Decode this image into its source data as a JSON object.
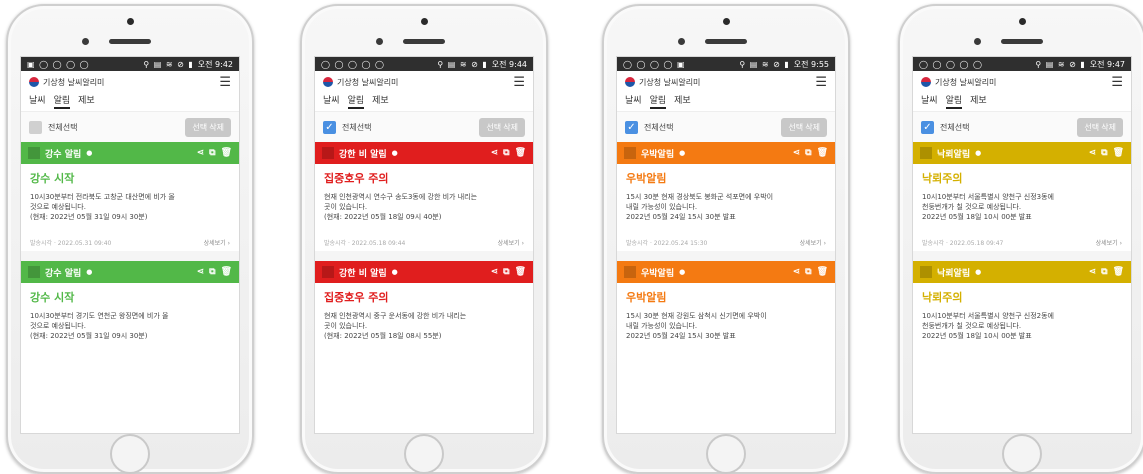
{
  "phones": [
    {
      "status": {
        "left_icons": "▣ ◯ ◯ ◯ ◯",
        "right_icons": "⚲ ▤ ≋ ⊘ ▮",
        "time": "오전 9:42"
      },
      "app_title": "기상청 날씨알리미",
      "tabs": [
        "날씨",
        "알림",
        "제보"
      ],
      "select_all_label": "전체선택",
      "select_all_checked": false,
      "delete_label": "선택 삭제",
      "accent": "#52b848",
      "alerts": [
        {
          "header": "강수 알림",
          "title": "강수 시작",
          "body": [
            "10시30분부터 전라북도 고창군 대산면에 비가 올",
            "것으로 예상됩니다.",
            "(현재: 2022년 05월 31일 09시 30분)"
          ],
          "meta_left": "발송시각 · 2022.05.31 09:40",
          "meta_right": "상세보기 ›"
        },
        {
          "header": "강수 알림",
          "title": "강수 시작",
          "body": [
            "10시30분부터 경기도 연천군 왕징면에 비가 올",
            "것으로 예상됩니다.",
            "(현재: 2022년 05월 31일 09시 30분)"
          ],
          "meta_left": "",
          "meta_right": ""
        }
      ]
    },
    {
      "status": {
        "left_icons": "◯ ◯ ◯ ◯ ◯",
        "right_icons": "⚲ ▤ ≋ ⊘ ▮",
        "time": "오전 9:44"
      },
      "app_title": "기상청 날씨알리미",
      "tabs": [
        "날씨",
        "알림",
        "제보"
      ],
      "select_all_label": "전체선택",
      "select_all_checked": true,
      "delete_label": "선택 삭제",
      "accent": "#e01e1e",
      "alerts": [
        {
          "header": "강한 비 알림",
          "title": "집중호우 주의",
          "body": [
            "현재 인천광역시 연수구 송도3동에 강한 비가 내리는",
            "곳이 있습니다.",
            "(현재: 2022년 05월 18일 09시 40분)"
          ],
          "meta_left": "발송시각 · 2022.05.18 09:44",
          "meta_right": "상세보기 ›"
        },
        {
          "header": "강한 비 알림",
          "title": "집중호우 주의",
          "body": [
            "현재 인천광역시 중구 운서동에 강한 비가 내리는",
            "곳이 있습니다.",
            "(현재: 2022년 05월 18일 08시 55분)"
          ],
          "meta_left": "",
          "meta_right": ""
        }
      ]
    },
    {
      "status": {
        "left_icons": "◯ ◯ ◯ ◯ ▣",
        "right_icons": "⚲ ▤ ≋ ⊘ ▮",
        "time": "오전 9:55"
      },
      "app_title": "기상청 날씨알리미",
      "tabs": [
        "날씨",
        "알림",
        "제보"
      ],
      "select_all_label": "전체선택",
      "select_all_checked": true,
      "delete_label": "선택 삭제",
      "accent": "#f47a12",
      "alerts": [
        {
          "header": "우박알림",
          "title": "우박알림",
          "body": [
            "15시 30분 현재 경상북도 봉화군 석포면에 우박이",
            "내릴 가능성이 있습니다.",
            "2022년 05월 24일 15시 30분 발표"
          ],
          "meta_left": "발송시각 · 2022.05.24 15:30",
          "meta_right": "상세보기 ›"
        },
        {
          "header": "우박알림",
          "title": "우박알림",
          "body": [
            "15시 30분 현재 강원도 삼척시 신기면에 우박이",
            "내릴 가능성이 있습니다.",
            "2022년 05월 24일 15시 30분 발표"
          ],
          "meta_left": "",
          "meta_right": ""
        }
      ]
    },
    {
      "status": {
        "left_icons": "◯ ◯ ◯ ◯ ◯",
        "right_icons": "⚲ ▤ ≋ ⊘ ▮",
        "time": "오전 9:47"
      },
      "app_title": "기상청 날씨알리미",
      "tabs": [
        "날씨",
        "알림",
        "제보"
      ],
      "select_all_label": "전체선택",
      "select_all_checked": true,
      "delete_label": "선택 삭제",
      "accent": "#d4b000",
      "alerts": [
        {
          "header": "낙뢰알림",
          "title": "낙뢰주의",
          "body": [
            "10시10분부터 서울특별시 양천구 신정3동에",
            "천둥번개가 칠 것으로 예상됩니다.",
            "2022년 05월 18일 10시 00분 발표"
          ],
          "meta_left": "발송시각 · 2022.05.18 09:47",
          "meta_right": "상세보기 ›"
        },
        {
          "header": "낙뢰알림",
          "title": "낙뢰주의",
          "body": [
            "10시10분부터 서울특별시 양천구 신정2동에",
            "천둥번개가 칠 것으로 예상됩니다.",
            "2022년 05월 18일 10시 00분 발표"
          ],
          "meta_left": "",
          "meta_right": ""
        }
      ]
    }
  ]
}
